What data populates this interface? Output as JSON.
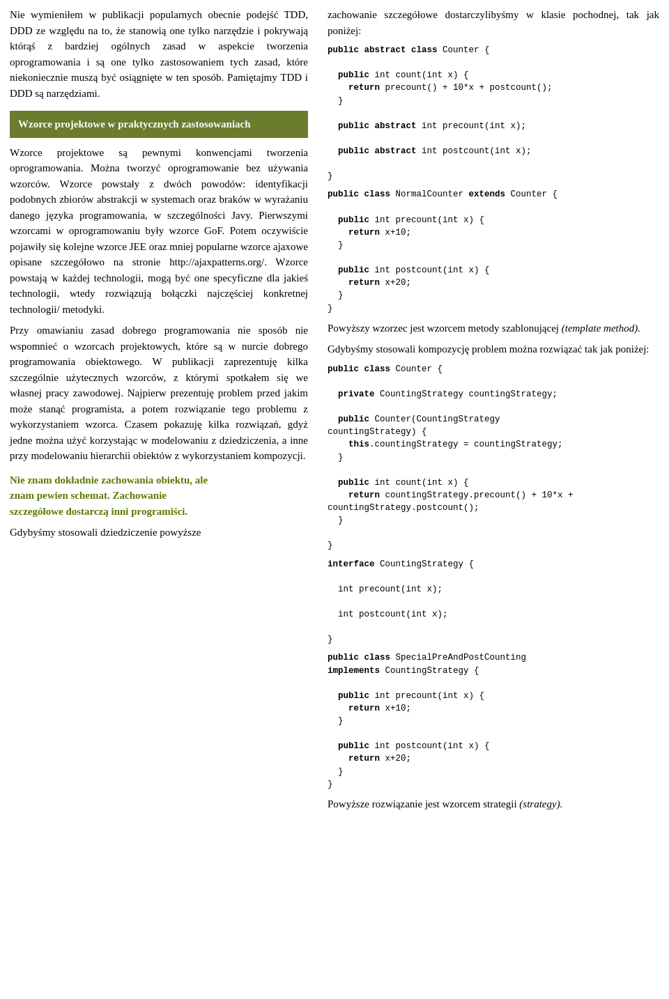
{
  "left": {
    "p1": "Nie wymieniłem w publikacji popularnych obecnie podejść TDD, DDD ze względu na to, że stanowią one tylko narzędzie i pokrywają którąś z bardziej ogólnych zasad w aspekcie tworzenia oprogramowania i są one tylko zastosowaniem tych zasad, które niekoniecznie muszą być osiągnięte w ten sposób. Pamiętajmy TDD i DDD są narzędziami.",
    "section_header": "Wzorce projektowe w praktycznych zastosowaniach",
    "p2": "Wzorce projektowe są pewnymi konwencjami tworzenia oprogramowania. Można tworzyć oprogramowanie bez używania wzorców. Wzorce powstały z dwóch powodów: identyfikacji podobnych zbiorów abstrakcji w systemach oraz braków w wyrażaniu danego języka programowania, w szczególności Javy. Pierwszymi wzorcami w oprogramowaniu były wzorce GoF. Potem oczywiście pojawiły się kolejne wzorce JEE oraz mniej popularne wzorce ajaxowe opisane szczegółowo na stronie http://ajaxpatterns.org/. Wzorce powstają w każdej technologii, mogą być one specyficzne dla jakieś technologii, wtedy rozwiązują bołączki najczęściej konkretnej technologii/ metodyki.",
    "p3": "Przy omawianiu zasad dobrego programowania nie sposób nie wspomnieć o wzorcach projektowych, które są w nurcie dobrego programowania obiektowego. W publikacji zaprezentuję kilka szczególnie użytecznych wzorców, z którymi spotkałem się we własnej pracy zawodowej. Najpierw prezentuję problem przed jakim może stanąć programista, a potem rozwiązanie tego problemu z wykorzystaniem wzorca. Czasem pokazuję kilka rozwiązań, gdyż jedne można użyć korzystając w modelowaniu z dziedziczenia, a inne przy modelowaniu hierarchii obiektów z wykorzystaniem kompozycji.",
    "green_line1": "Nie znam dokładnie zachowania obiektu, ale",
    "green_line2": "znam pewien schemat. Zachowanie",
    "green_line3": "szczegółowe dostarczą inni programiści.",
    "p4": "Gdybyśmy stosowali dziedziczenie powyższe"
  },
  "right": {
    "p1": "zachowanie szczegółowe dostarczylibyśmy w klasie pochodnej, tak jak poniżej:",
    "code1": "public abstract class Counter {\n\n  public int count(int x) {\n    return precount() + 10*x + postcount();\n  }\n\n  public abstract int precount(int x);\n\n  public abstract int postcount(int x);\n\n}",
    "code2": "public class NormalCounter extends Counter {\n\n  public int precount(int x) {\n    return x+10;\n  }\n\n  public int postcount(int x) {\n    return x+20;\n  }\n}",
    "p2": "Powyższy wzorzec jest wzorcem metody szablonującej",
    "p2_italic": "(template method).",
    "p3": "Gdybyśmy stosowali kompozycję problem można rozwiązać tak jak poniżej:",
    "code3": "public class Counter {\n\n  private CountingStrategy countingStrategy;\n\n  public Counter(CountingStrategy\ncountingStrategy) {\n    this.countingStrategy = countingStrategy;\n  }\n\n  public int count(int x) {\n    return countingStrategy.precount() + 10*x +\ncountingStrategy.postcount();\n  }\n\n}",
    "code4": "interface CountingStrategy {\n\n  int precount(int x);\n\n  int postcount(int x);\n\n}",
    "code5": "public class SpecialPreAndPostCounting\nimplements CountingStrategy {\n\n  public int precount(int x) {\n    return x+10;\n  }\n\n  public int postcount(int x) {\n    return x+20;\n  }\n}",
    "p4": "Powyższe rozwiązanie jest wzorcem strategii",
    "p4_italic": "(strategy)."
  }
}
